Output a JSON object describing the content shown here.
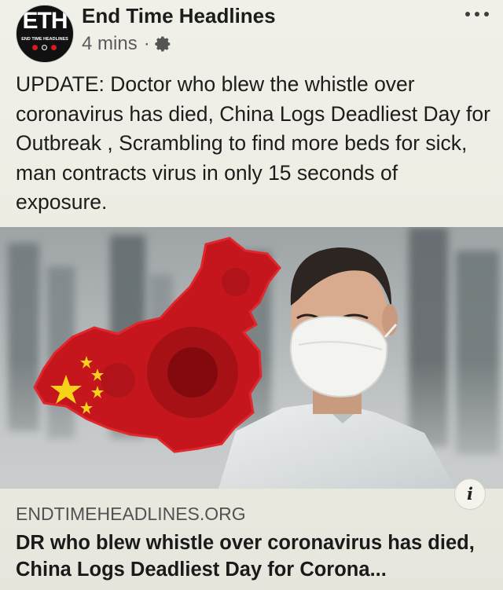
{
  "header": {
    "page_name": "End Time Headlines",
    "timestamp": "4 mins",
    "separator": "·",
    "avatar_logo": "ETH",
    "avatar_subtitle": "END TIME HEADLINES"
  },
  "icons": {
    "audience": "gear-icon",
    "menu": "more-options-icon",
    "info": "info-icon"
  },
  "post": {
    "text": "UPDATE: Doctor who blew the whistle over coronavirus has died, China Logs Deadliest Day for Outbreak , Scrambling to find more beds for sick, man contracts virus in only 15 seconds of exposure."
  },
  "link_preview": {
    "info_label": "i",
    "domain": "ENDTIMEHEADLINES.ORG",
    "title": "DR who blew whistle over coronavirus has died, China Logs Deadliest Day for Corona..."
  },
  "colors": {
    "background": "#ecebe3",
    "text": "#1c1c1c",
    "muted_text": "#5b5b5b",
    "map_red": "#c4161c",
    "flag_star": "#f6d21b"
  }
}
